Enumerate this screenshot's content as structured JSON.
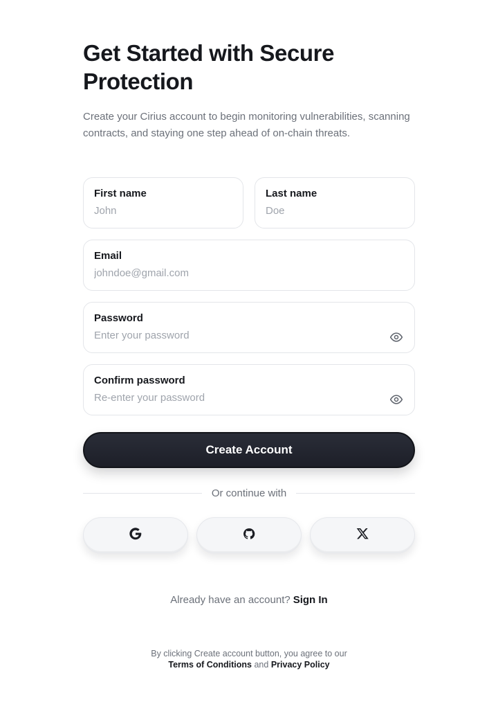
{
  "header": {
    "title": "Get Started with Secure Protection",
    "subtitle": "Create your Cirius account to begin monitoring vulnerabilities, scanning contracts, and staying one step ahead of on-chain threats."
  },
  "form": {
    "first_name": {
      "label": "First name",
      "value": "",
      "placeholder": "John"
    },
    "last_name": {
      "label": "Last name",
      "value": "",
      "placeholder": "Doe"
    },
    "email": {
      "label": "Email",
      "value": "",
      "placeholder": "johndoe@gmail.com"
    },
    "password": {
      "label": "Password",
      "value": "",
      "placeholder": "Enter your password",
      "icon": "eye-icon"
    },
    "confirm_password": {
      "label": "Confirm password",
      "value": "",
      "placeholder": "Re-enter your password",
      "icon": "eye-icon"
    },
    "submit_label": "Create Account"
  },
  "social": {
    "divider_text": "Or continue with",
    "providers": [
      {
        "icon": "google-icon"
      },
      {
        "icon": "github-icon"
      },
      {
        "icon": "x-icon"
      }
    ]
  },
  "signin": {
    "prompt": "Already have an account?",
    "link_label": "Sign In"
  },
  "terms": {
    "prefix": "By clicking Create account button, you agree to our",
    "terms_label": "Terms of Conditions",
    "conjunction": "and",
    "privacy_label": "Privacy Policy"
  },
  "colors": {
    "primary_button": "#1d1f28",
    "text_dark": "#16181d",
    "text_muted": "#6b7079",
    "border": "#e3e5e9",
    "social_bg": "#f5f6f8"
  }
}
